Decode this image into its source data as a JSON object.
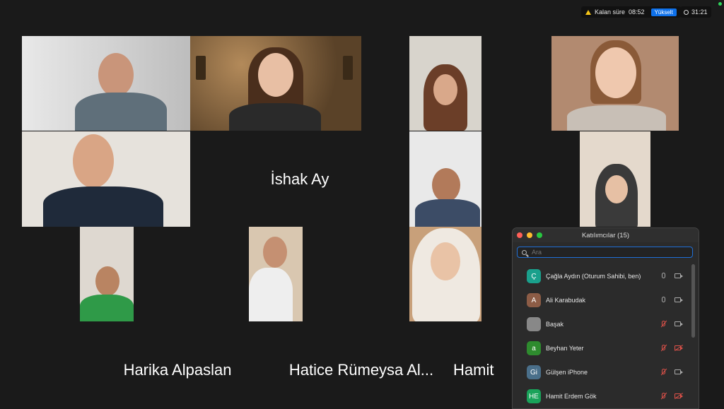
{
  "status": {
    "remaining_label": "Kalan süre",
    "remaining_time": "08:52",
    "upgrade_label": "Yükselt",
    "meeting_clock": "31:21"
  },
  "gallery": {
    "name_tiles": [
      "İshak Ay",
      "Harika Alpaslan",
      "Hatice Rümeysa Al...",
      "Hamit"
    ]
  },
  "participants_panel": {
    "title": "Katılımcılar (15)",
    "search_placeholder": "Ara",
    "participants": [
      {
        "initial": "Ç",
        "name": "Çağla Aydın (Oturum Sahibi, ben)",
        "avatar_color": "#1aa08c",
        "mic": "on",
        "camera": "on"
      },
      {
        "initial": "A",
        "name": "Ali Karabudak",
        "avatar_color": "#8c5c46",
        "mic": "on",
        "camera": "on"
      },
      {
        "initial": "",
        "name": "Başak",
        "avatar_color": "#888888",
        "mic": "muted",
        "camera": "on"
      },
      {
        "initial": "a",
        "name": "Beyhan Yeter",
        "avatar_color": "#2e8b2e",
        "mic": "muted",
        "camera": "off"
      },
      {
        "initial": "Gi",
        "name": "Gülşen iPhone",
        "avatar_color": "#4a6f8a",
        "mic": "muted",
        "camera": "on"
      },
      {
        "initial": "HE",
        "name": "Hamit Erdem Gök",
        "avatar_color": "#19a35a",
        "mic": "muted",
        "camera": "off"
      }
    ]
  }
}
